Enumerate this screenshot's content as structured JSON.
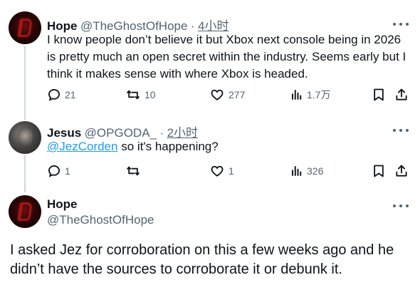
{
  "tweets": [
    {
      "name": "Hope",
      "handle": "@TheGhostOfHope",
      "separator": "·",
      "time": "4小时",
      "text": "I know people don’t believe it but Xbox next console being in 2026 is pretty much an open secret within the industry. Seems early but I think it makes sense with where Xbox is headed.",
      "replies": "21",
      "retweets": "10",
      "likes": "277",
      "views": "1.7万"
    },
    {
      "name": "Jesus",
      "handle": "@OPGODA_",
      "separator": "·",
      "time": "2小时",
      "mention": "@JezCorden",
      "text": " so it's happening?",
      "replies": "1",
      "retweets": "",
      "likes": "1",
      "views": "326"
    }
  ],
  "main": {
    "name": "Hope",
    "handle": "@TheGhostOfHope",
    "text": "I asked Jez for corroboration on this a few weeks ago and he didn’t have the sources to corroborate it or debunk it."
  },
  "colors": {
    "accent": "#1d9bf0",
    "secondary": "#536471",
    "text": "#0f1419",
    "thread_line": "#cfd9de"
  },
  "icons": [
    "reply-icon",
    "retweet-icon",
    "like-icon",
    "views-icon",
    "bookmark-icon",
    "share-icon",
    "more-icon"
  ]
}
